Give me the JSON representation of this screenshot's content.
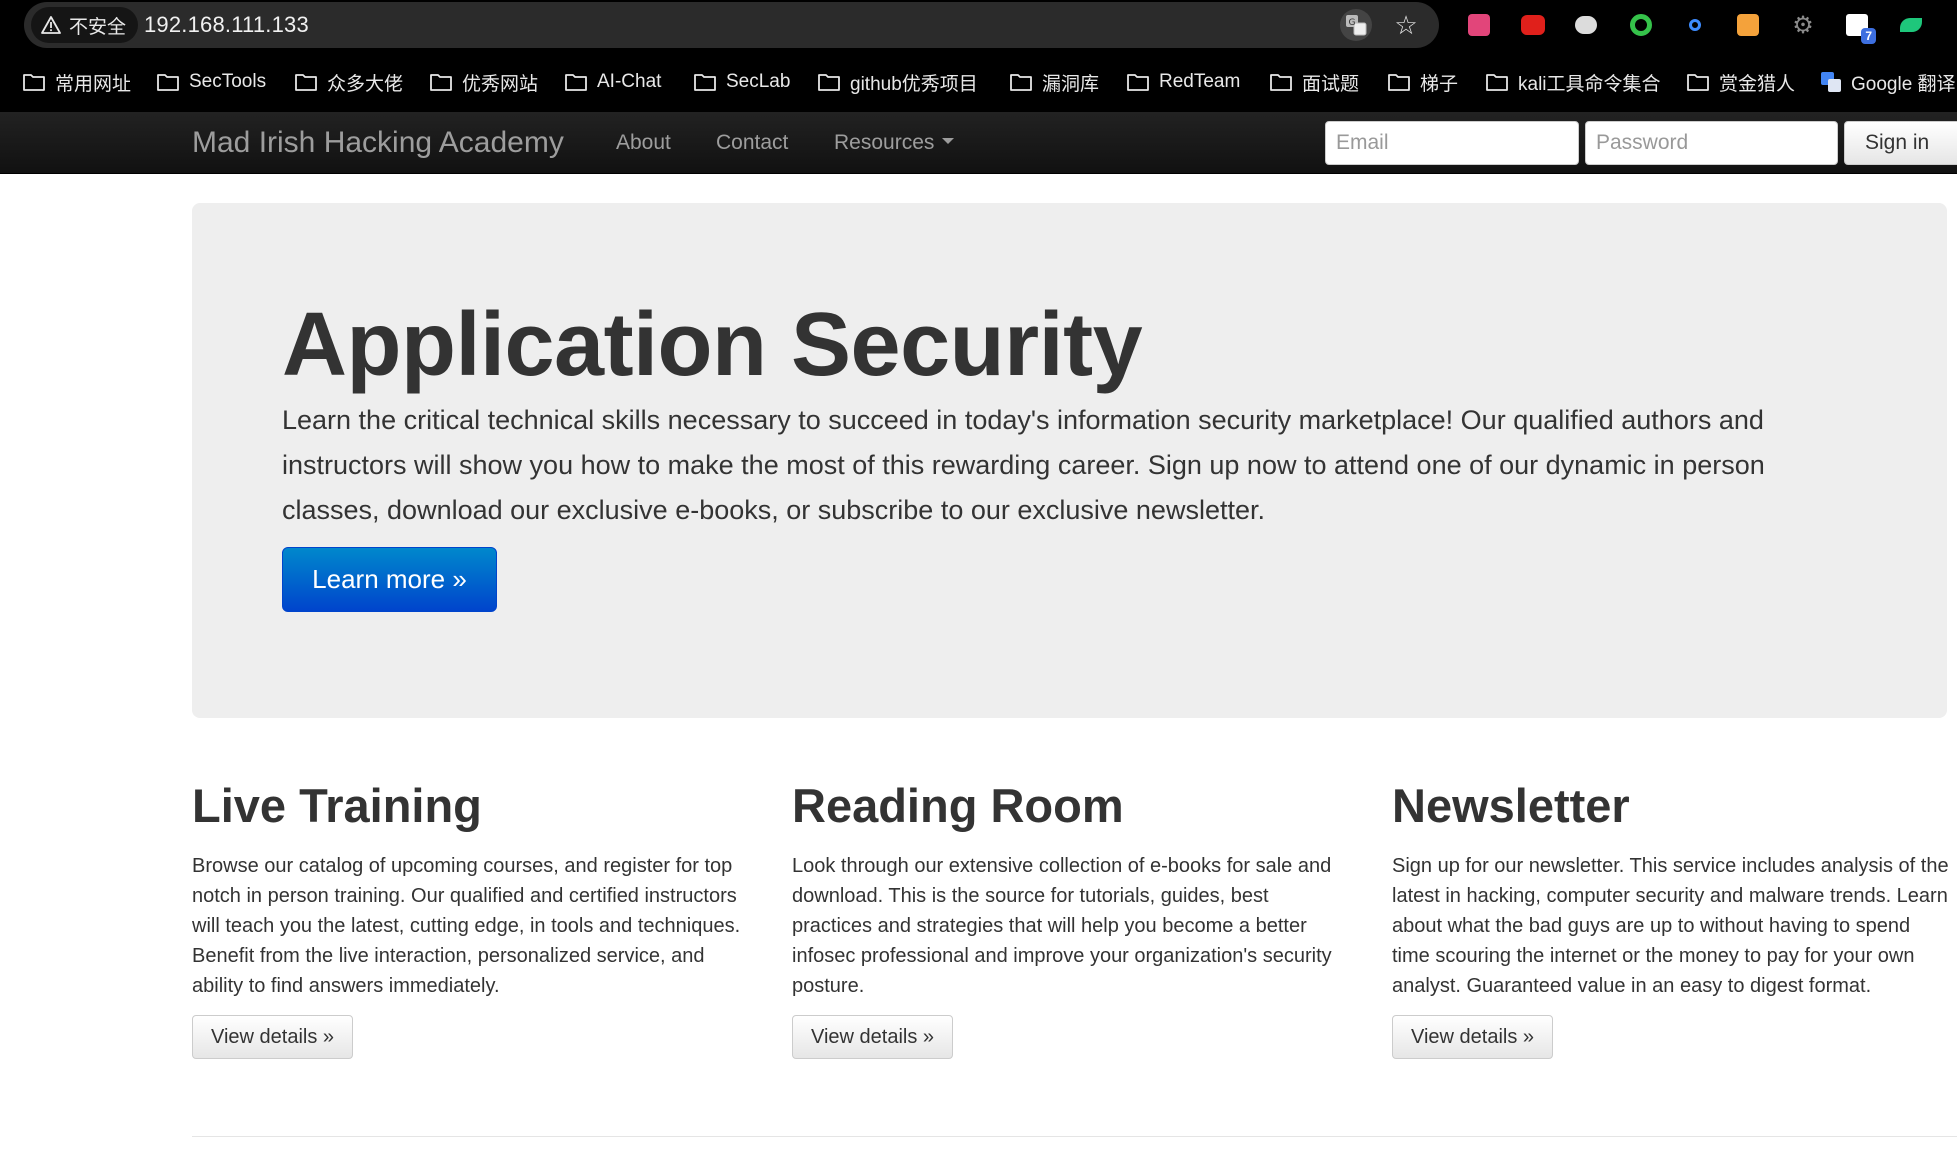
{
  "browser": {
    "security_label": "不安全",
    "url": "192.168.111.133",
    "bookmarks": [
      {
        "label": "常用网址"
      },
      {
        "label": "SecTools"
      },
      {
        "label": "众多大佬"
      },
      {
        "label": "优秀网站"
      },
      {
        "label": "AI-Chat"
      },
      {
        "label": "SecLab"
      },
      {
        "label": "github优秀项目"
      },
      {
        "label": "漏洞库"
      },
      {
        "label": "RedTeam"
      },
      {
        "label": "面试题"
      },
      {
        "label": "梯子"
      },
      {
        "label": "kali工具命令集合"
      },
      {
        "label": "赏金猎人"
      },
      {
        "label": "Google 翻译"
      }
    ],
    "extension_badge": "7"
  },
  "navbar": {
    "brand": "Mad Irish Hacking Academy",
    "links": {
      "about": "About",
      "contact": "Contact",
      "resources": "Resources"
    },
    "email_placeholder": "Email",
    "password_placeholder": "Password",
    "signin_label": "Sign in"
  },
  "hero": {
    "title": "Application Security",
    "text": "Learn the critical technical skills necessary to succeed in today's information security marketplace! Our qualified authors and instructors will show you how to make the most of this rewarding career. Sign up now to attend one of our dynamic in person classes, download our exclusive e-books, or subscribe to our exclusive newsletter.",
    "button_label": "Learn more »"
  },
  "columns": [
    {
      "heading": "Live Training",
      "text": "Browse our catalog of upcoming courses, and register for top notch in person training. Our qualified and certified instructors will teach you the latest, cutting edge, in tools and techniques. Benefit from the live interaction, personalized service, and ability to find answers immediately.",
      "button_label": "View details »"
    },
    {
      "heading": "Reading Room",
      "text": "Look through our extensive collection of e-books for sale and download. This is the source for tutorials, guides, best practices and strategies that will help you become a better infosec professional and improve your organization's security posture.",
      "button_label": "View details »"
    },
    {
      "heading": "Newsletter",
      "text": "Sign up for our newsletter. This service includes analysis of the latest in hacking, computer security and malware trends. Learn about what the bad guys are up to without having to spend time scouring the internet or the money to pay for your own analyst. Guaranteed value in an easy to digest format.",
      "button_label": "View details »"
    }
  ],
  "colors": {
    "navbar_bg": "#1b1b1b",
    "hero_bg": "#eeeeee",
    "primary_button": "#0055cc",
    "text": "#333333"
  }
}
